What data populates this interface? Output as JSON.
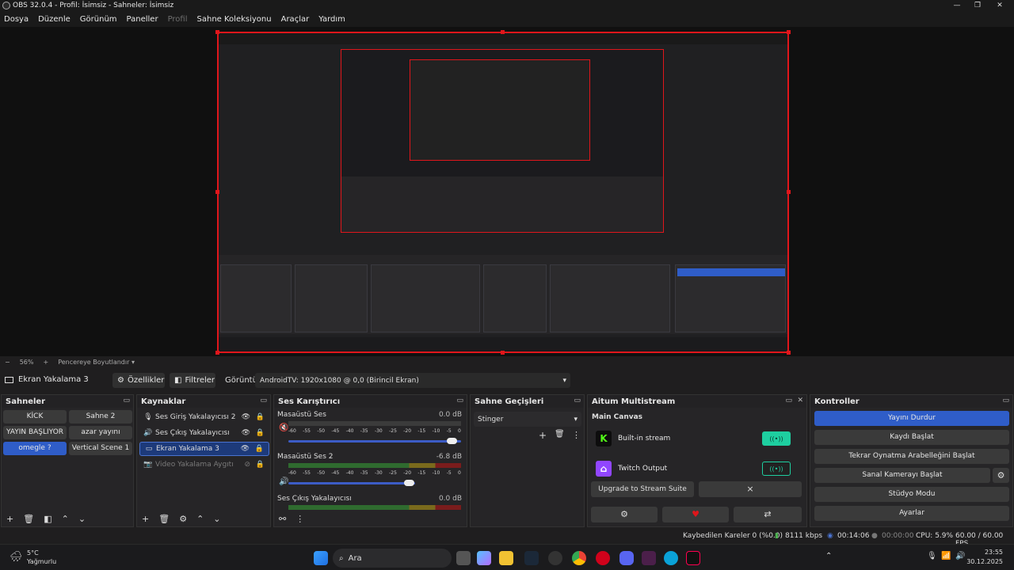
{
  "window": {
    "title": "OBS 32.0.4 - Profil: İsimsiz - Sahneler: İsimsiz",
    "minimize": "—",
    "maximize": "❐",
    "close": "✕"
  },
  "menu": [
    "Dosya",
    "Düzenle",
    "Görünüm",
    "Paneller",
    "Profil",
    "Sahne Koleksiyonu",
    "Araçlar",
    "Yardım"
  ],
  "zoom": {
    "minus": "−",
    "value": "56%",
    "plus": "+",
    "fit": "Pencereye Boyutlandır"
  },
  "source_toolbar": {
    "source_name": "Ekran Yakalama 3",
    "properties": "Özellikler",
    "filters": "Filtreler",
    "display_label": "Görüntü",
    "display_value": "AndroidTV: 1920x1080 @ 0,0 (Birincil Ekran)"
  },
  "scenes": {
    "title": "Sahneler",
    "items": [
      "KİCK",
      "Sahne 2",
      "YAYIN BAŞLIYOR",
      "azar yayını",
      "omegle ?",
      "Vertical Scene 1"
    ],
    "selected": "omegle ?"
  },
  "sources": {
    "title": "Kaynaklar",
    "items": [
      {
        "label": "Ses Giriş Yakalayıcısı 2",
        "icon": "microphone-icon"
      },
      {
        "label": "Ses Çıkış Yakalayıcısı",
        "icon": "speaker-icon"
      },
      {
        "label": "Ekran Yakalama 3",
        "icon": "monitor-icon"
      },
      {
        "label": "Video Yakalama Aygıtı",
        "icon": "camera-icon"
      }
    ]
  },
  "mixer": {
    "title": "Ses Karıştırıcı",
    "ticks": [
      "-60",
      "-55",
      "-50",
      "-45",
      "-40",
      "-35",
      "-30",
      "-25",
      "-20",
      "-15",
      "-10",
      "-5",
      "0"
    ],
    "channels": [
      {
        "name": "Masaüstü Ses",
        "db": "0.0 dB",
        "level": 0.0
      },
      {
        "name": "Masaüstü Ses 2",
        "db": "-6.8 dB",
        "level": 0.68
      },
      {
        "name": "Ses Çıkış Yakalayıcısı",
        "db": "0.0 dB",
        "level": 0.0
      }
    ]
  },
  "transitions": {
    "title": "Sahne Geçişleri",
    "value": "Stinger"
  },
  "multistream": {
    "title": "Aitum Multistream",
    "canvas": "Main Canvas",
    "outputs": [
      {
        "name": "Built-in stream",
        "logo": "K",
        "color": "#53fc18"
      },
      {
        "name": "Twitch Output",
        "logo": "⌂",
        "color": "#9146ff"
      }
    ],
    "upgrade": "Upgrade to Stream Suite",
    "close": "×"
  },
  "controls": {
    "title": "Kontroller",
    "buttons": [
      "Yayını Durdur",
      "Kaydı Başlat",
      "Tekrar Oynatma Arabelleğini Başlat",
      "Sanal Kamerayı Başlat",
      "Stüdyo Modu",
      "Ayarlar"
    ]
  },
  "status": {
    "dropped": "Kaybedilen Kareler 0 (%0.0)",
    "bitrate": "8111 kbps",
    "stream_time": "00:14:06",
    "rec_time": "00:00:00",
    "cpu": "CPU: 5.9%",
    "fps": "60.00 / 60.00 FPS"
  },
  "taskbar": {
    "weather_temp": "5°C",
    "weather_desc": "Yağmurlu",
    "search": "Ara",
    "time": "23:55",
    "date": "30.12.2025"
  }
}
